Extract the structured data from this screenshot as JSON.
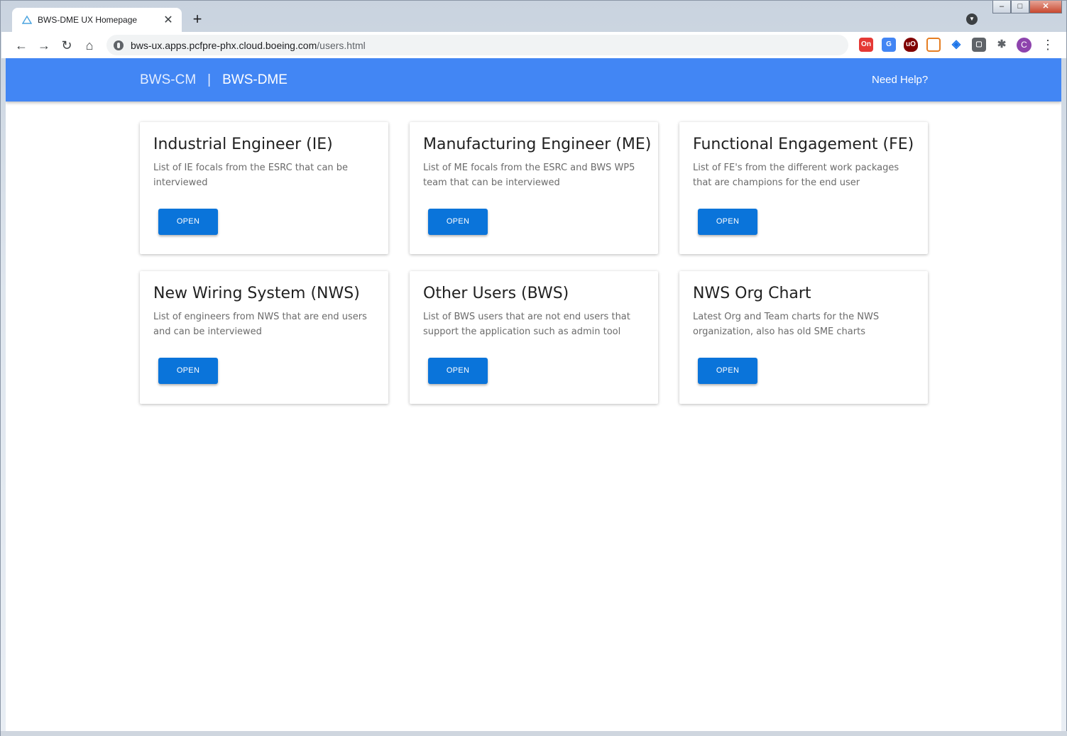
{
  "browser": {
    "tab_title": "BWS-DME UX Homepage",
    "new_tab": "+",
    "close_tab": "✕",
    "url_host": "bws-ux.apps.pcfpre-phx.cloud.boeing.com",
    "url_path": "/users.html",
    "avatar_letter": "C",
    "ext_badge": "On",
    "ext_ublock": "uO"
  },
  "header": {
    "brand_primary": "BWS-CM",
    "separator": "|",
    "brand_secondary": "BWS-DME",
    "help_link": "Need Help?"
  },
  "cards": [
    {
      "title": "Industrial Engineer (IE)",
      "description": "List of IE focals from the ESRC that can be interviewed",
      "button": "OPEN"
    },
    {
      "title": "Manufacturing Engineer (ME)",
      "description": "List of ME focals from the ESRC and BWS WP5 team that can be interviewed",
      "button": "OPEN"
    },
    {
      "title": "Functional Engagement (FE)",
      "description": "List of FE's from the different work packages that are champions for the end user",
      "button": "OPEN"
    },
    {
      "title": "New Wiring System (NWS)",
      "description": "List of engineers from NWS that are end users and can be interviewed",
      "button": "OPEN"
    },
    {
      "title": "Other Users (BWS)",
      "description": "List of BWS users that are not end users that support the application such as admin tool",
      "button": "OPEN"
    },
    {
      "title": "NWS Org Chart",
      "description": "Latest Org and Team charts for the NWS organization, also has old SME charts",
      "button": "OPEN"
    }
  ],
  "colors": {
    "app_bar": "#4286f4",
    "button": "#0a74da"
  }
}
